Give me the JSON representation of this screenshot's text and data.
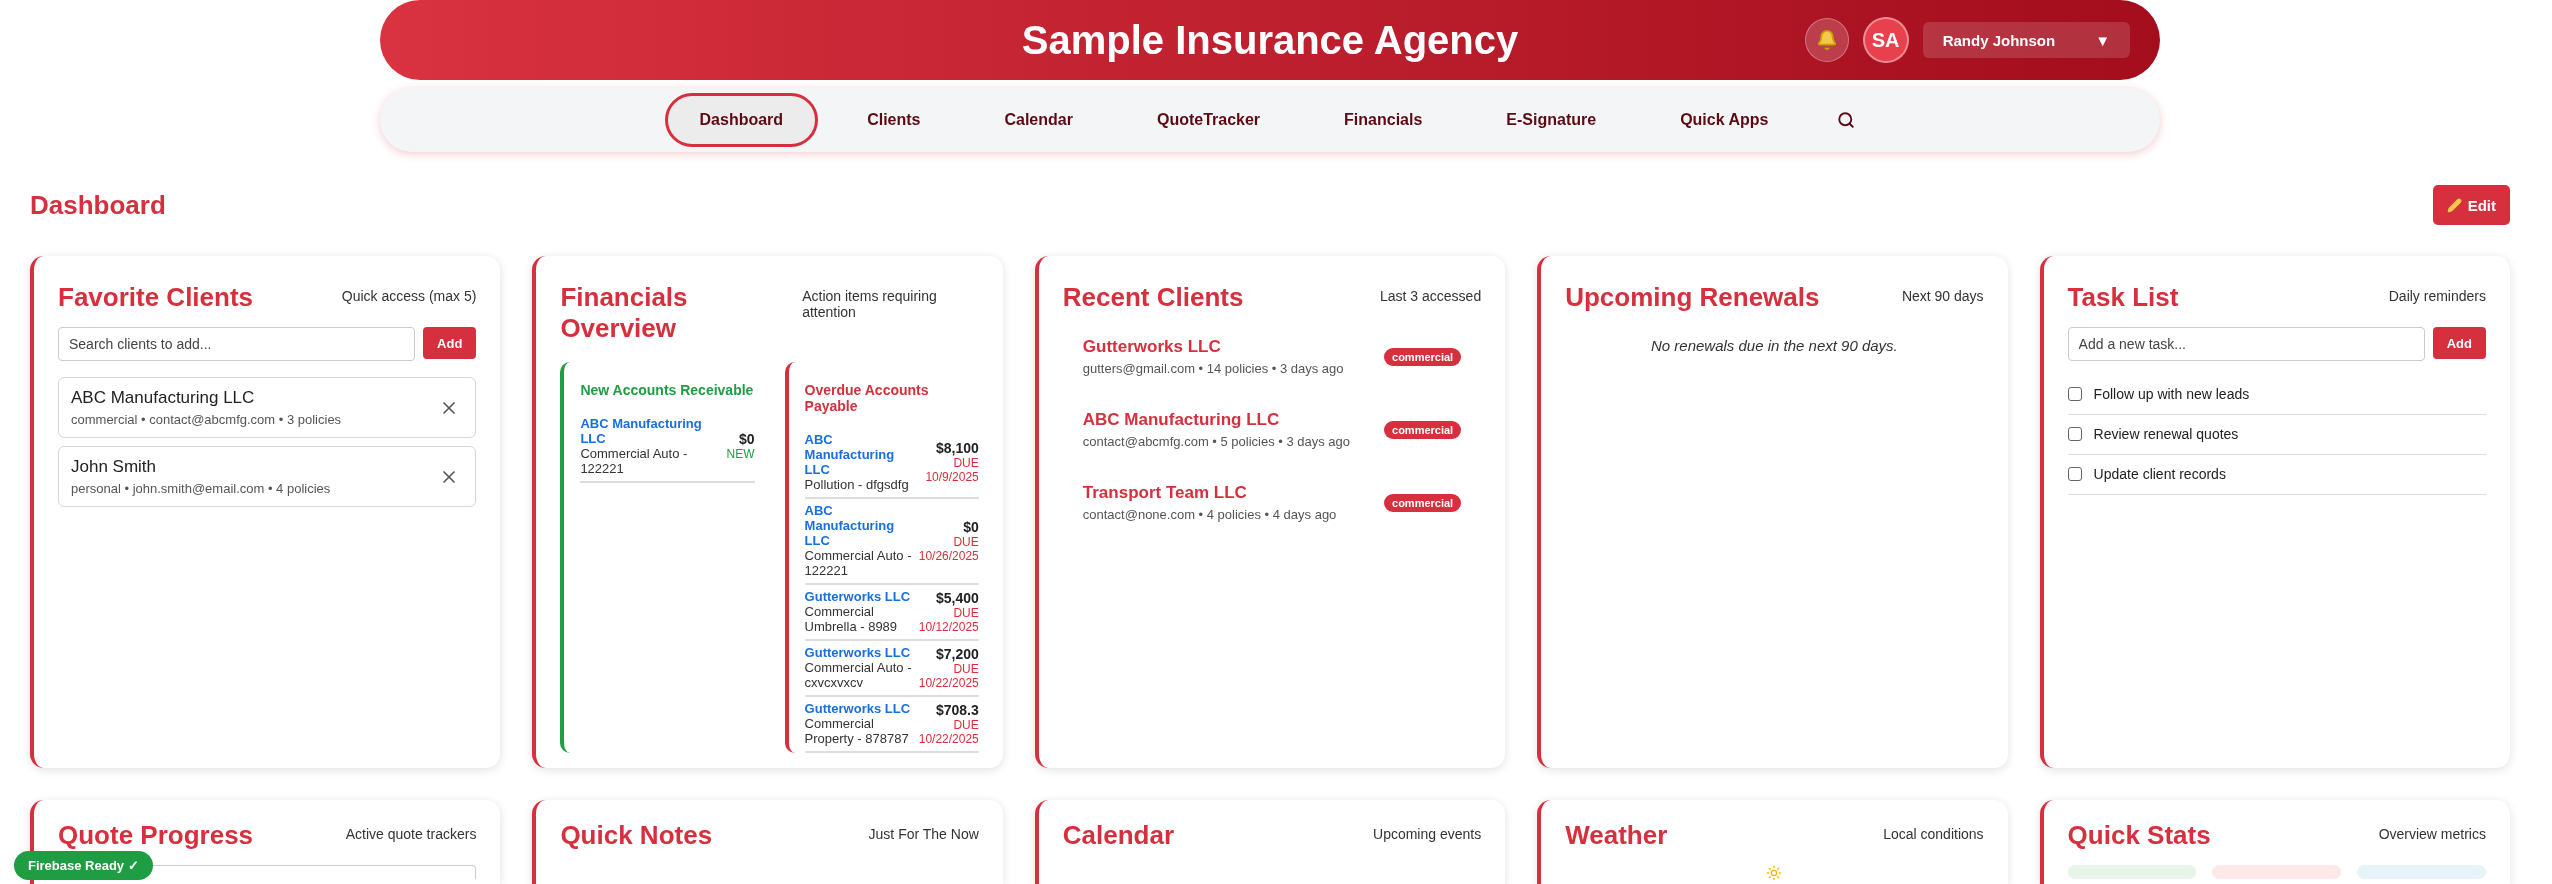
{
  "header": {
    "title": "Sample Insurance Agency",
    "avatar": "SA",
    "user": "Randy Johnson",
    "caret": "▼"
  },
  "nav": [
    {
      "label": "Dashboard",
      "selected": true
    },
    {
      "label": "Clients",
      "selected": false
    },
    {
      "label": "Calendar",
      "selected": false
    },
    {
      "label": "QuoteTracker",
      "selected": false
    },
    {
      "label": "Financials",
      "selected": false
    },
    {
      "label": "E-Signature",
      "selected": false
    },
    {
      "label": "Quick Apps",
      "selected": false
    }
  ],
  "page": {
    "title": "Dashboard",
    "edit_button": "Edit"
  },
  "favorite_clients": {
    "title": "Favorite Clients",
    "subtitle": "Quick access (max 5)",
    "search_placeholder": "Search clients to add...",
    "add_button": "Add",
    "clients": [
      {
        "name": "ABC Manufacturing LLC",
        "meta": "commercial • contact@abcmfg.com • 3 policies"
      },
      {
        "name": "John Smith",
        "meta": "personal • john.smith@email.com • 4 policies"
      }
    ]
  },
  "financials": {
    "title": "Financials Overview",
    "subtitle": "Action items requiring attention",
    "receivable": {
      "title": "New Accounts Receivable",
      "items": [
        {
          "client": "ABC Manufacturing LLC",
          "policy": "Commercial Auto - 122221",
          "amount": "$0",
          "status": "NEW"
        }
      ]
    },
    "payable": {
      "title": "Overdue Accounts Payable",
      "items": [
        {
          "client": "ABC Manufacturing LLC",
          "policy": "Pollution - dfgsdfg",
          "amount": "$8,100",
          "status": "DUE",
          "date": "10/9/2025"
        },
        {
          "client": "ABC Manufacturing LLC",
          "policy": "Commercial Auto - 122221",
          "amount": "$0",
          "status": "DUE",
          "date": "10/26/2025"
        },
        {
          "client": "Gutterworks LLC",
          "policy": "Commercial Umbrella - 8989",
          "amount": "$5,400",
          "status": "DUE",
          "date": "10/12/2025"
        },
        {
          "client": "Gutterworks LLC",
          "policy": "Commercial Auto - cxvcxvxcv",
          "amount": "$7,200",
          "status": "DUE",
          "date": "10/22/2025"
        },
        {
          "client": "Gutterworks LLC",
          "policy": "Commercial Property - 878787",
          "amount": "$708.3",
          "status": "DUE",
          "date": "10/22/2025"
        }
      ]
    }
  },
  "recent_clients": {
    "title": "Recent Clients",
    "subtitle": "Last 3 accessed",
    "clients": [
      {
        "name": "Gutterworks LLC",
        "meta": "gutters@gmail.com • 14 policies • 3 days ago",
        "tag": "commercial"
      },
      {
        "name": "ABC Manufacturing LLC",
        "meta": "contact@abcmfg.com • 5 policies • 3 days ago",
        "tag": "commercial"
      },
      {
        "name": "Transport Team LLC",
        "meta": "contact@none.com • 4 policies • 4 days ago",
        "tag": "commercial"
      }
    ]
  },
  "renewals": {
    "title": "Upcoming Renewals",
    "subtitle": "Next 90 days",
    "empty": "No renewals due in the next 90 days."
  },
  "tasks": {
    "title": "Task List",
    "subtitle": "Daily reminders",
    "placeholder": "Add a new task...",
    "add_button": "Add",
    "items": [
      {
        "label": "Follow up with new leads",
        "checked": false
      },
      {
        "label": "Review renewal quotes",
        "checked": false
      },
      {
        "label": "Update client records",
        "checked": false
      }
    ]
  },
  "bottom_cards": [
    {
      "kind": "field",
      "title": "Quote Progress",
      "subtitle": "Active quote trackers"
    },
    {
      "kind": "plain",
      "title": "Quick Notes",
      "subtitle": "Just For The Now"
    },
    {
      "kind": "plain",
      "title": "Calendar",
      "subtitle": "Upcoming events"
    },
    {
      "kind": "weather",
      "title": "Weather",
      "subtitle": "Local conditions"
    },
    {
      "kind": "stats",
      "title": "Quick Stats",
      "subtitle": "Overview metrics"
    }
  ],
  "status_badge": {
    "label": "Firebase Ready ✓"
  }
}
